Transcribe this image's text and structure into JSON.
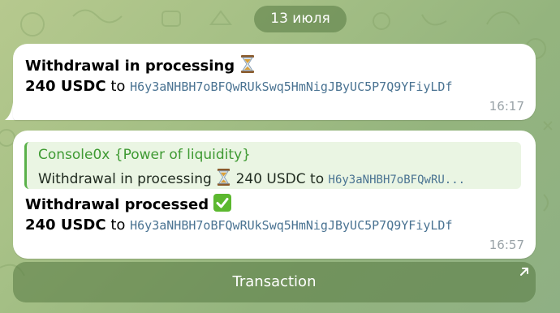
{
  "chat": {
    "date_separator": "13 июля",
    "messages": [
      {
        "title": "Withdrawal in processing",
        "status_emoji": "hourglass-icon",
        "amount": "240 USDC",
        "to_word": "to",
        "address": "H6y3aNHBH7oBFQwRUkSwq5HmNigJByUC5P7Q9YFiyLDf",
        "time": "16:17"
      },
      {
        "reply": {
          "author": "Console0x {Power of liquidity}",
          "text": "Withdrawal in processing",
          "amount": "240 USDC",
          "to_word": "to",
          "address_truncated": "H6y3aNHBH7oBFQwRU..."
        },
        "title": "Withdrawal processed",
        "status_emoji": "check-mark-icon",
        "amount": "240 USDC",
        "to_word": "to",
        "address": "H6y3aNHBH7oBFQwRUkSwq5HmNigJByUC5P7Q9YFiyLDf",
        "time": "16:57"
      }
    ],
    "inline_button": {
      "label": "Transaction",
      "icon": "external-arrow-icon"
    }
  },
  "colors": {
    "background": "#a4bf85",
    "bubble": "#ffffff",
    "address": "#4a7392",
    "quote_accent": "#5ab14a",
    "quote_bg": "#eaf5e3",
    "pill": "#567842"
  }
}
